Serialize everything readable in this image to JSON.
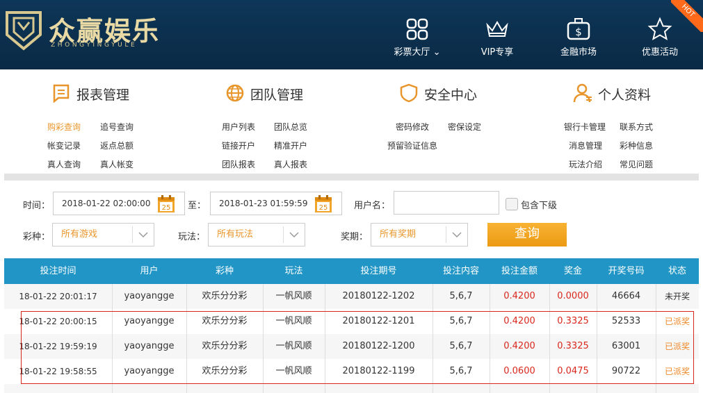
{
  "brand": {
    "title": "众赢娱乐",
    "subtitle": "ZHONGYINGYULE"
  },
  "nav": {
    "items": [
      {
        "label": "彩票大厅",
        "icon": "grid-icon"
      },
      {
        "label": "VIP专享",
        "icon": "crown-icon"
      },
      {
        "label": "金融市场",
        "icon": "briefcase-dollar-icon"
      },
      {
        "label": "优惠活动",
        "icon": "star-icon"
      }
    ],
    "hot_badge": "HOT"
  },
  "menu": {
    "sections": [
      {
        "title": "报表管理",
        "icon": "report-icon",
        "links": [
          "购彩查询",
          "追号查询",
          "帐变记录",
          "返点总额",
          "真人查询",
          "真人帐变"
        ]
      },
      {
        "title": "团队管理",
        "icon": "globe-icon",
        "links": [
          "用户列表",
          "团队总览",
          "链接开户",
          "精准开户",
          "团队报表",
          "真人报表"
        ]
      },
      {
        "title": "安全中心",
        "icon": "shield-icon",
        "links": [
          "密码修改",
          "密保设定",
          "预留验证信息"
        ]
      },
      {
        "title": "个人资料",
        "icon": "user-icon",
        "links": [
          "银行卡管理",
          "联系方式",
          "消息管理",
          "彩种信息",
          "玩法介绍",
          "常见问题"
        ]
      }
    ]
  },
  "filter": {
    "time_label": "时间：",
    "start_time": "2018-01-22 02:00:00",
    "to_label": "至：",
    "end_time": "2018-01-23 01:59:59",
    "calendar_day": "25",
    "username_label": "用户名：",
    "username_value": "",
    "include_sub_label": "包含下级",
    "lottery_label": "彩种：",
    "lottery_value": "所有游戏",
    "play_label": "玩法：",
    "play_value": "所有玩法",
    "period_label": "奖期：",
    "period_value": "所有奖期",
    "query_button": "查询"
  },
  "table": {
    "columns": [
      "投注时间",
      "用户",
      "彩种",
      "玩法",
      "投注期号",
      "投注内容",
      "投注金额",
      "奖金",
      "开奖号码",
      "状态"
    ],
    "rows": [
      [
        "18-01-22 20:01:17",
        "yaoyangge",
        "欢乐分分彩",
        "一帆风顺",
        "20180122-1202",
        "5,6,7",
        "0.4200",
        "0.0000",
        "46664",
        "未开奖"
      ],
      [
        "18-01-22 20:00:15",
        "yaoyangge",
        "欢乐分分彩",
        "一帆风顺",
        "20180122-1201",
        "5,6,7",
        "0.4200",
        "0.3325",
        "52533",
        "已派奖"
      ],
      [
        "18-01-22 19:59:19",
        "yaoyangge",
        "欢乐分分彩",
        "一帆风顺",
        "20180122-1200",
        "5,6,7",
        "0.4200",
        "0.3325",
        "63001",
        "已派奖"
      ],
      [
        "18-01-22 19:58:55",
        "yaoyangge",
        "欢乐分分彩",
        "一帆风顺",
        "20180122-1199",
        "5,6,7",
        "0.0600",
        "0.0475",
        "90722",
        "已派奖"
      ]
    ]
  },
  "colors": {
    "header_bg": "#0b2d4a",
    "accent": "#e8962b",
    "table_header": "#2196c6",
    "money_red": "#d9261c"
  }
}
